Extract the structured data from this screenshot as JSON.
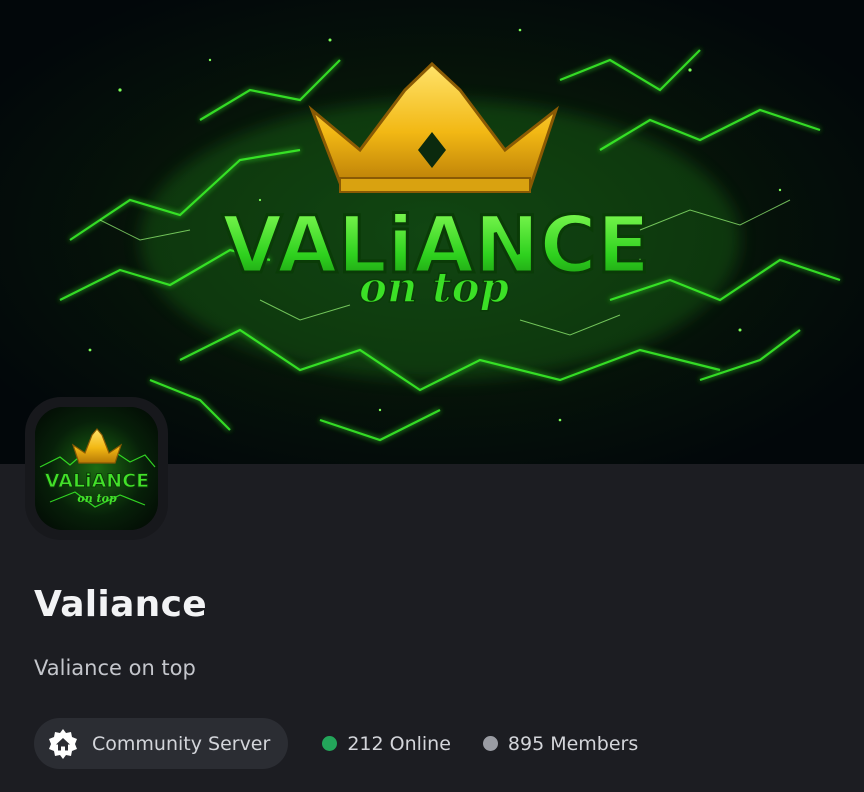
{
  "banner": {
    "logo_title": "VALiANCE",
    "logo_subtitle": "on top"
  },
  "avatar": {
    "logo_title": "VALiANCE",
    "logo_subtitle": "on top"
  },
  "server": {
    "name": "Valiance",
    "description": "Valiance on top"
  },
  "badge": {
    "label": "Community Server",
    "icon": "home-icon"
  },
  "stats": {
    "online": "212 Online",
    "members": "895 Members"
  },
  "colors": {
    "background": "#1c1d22",
    "online_dot": "#23a55a",
    "members_dot": "#9a9ca3",
    "logo_green": "#39d62a",
    "crown_gold": "#f3c21a"
  }
}
